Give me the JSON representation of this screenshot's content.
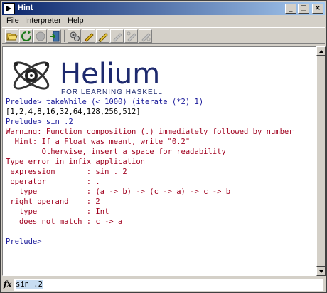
{
  "window": {
    "title": "Hint"
  },
  "title_buttons": {
    "minimize": "_",
    "maximize": "□",
    "close": "×"
  },
  "menu": {
    "file": {
      "first": "F",
      "rest": "ile"
    },
    "interpreter": {
      "first": "I",
      "rest": "nterpreter"
    },
    "help": {
      "first": "H",
      "rest": "elp"
    }
  },
  "toolbar": {
    "buttons": [
      "open-folder-icon",
      "reload-icon",
      "stop-icon",
      "exit-icon",
      "settings-icon",
      "edit-icon",
      "edit-file-icon",
      "edit-error-icon",
      "disabled-edit-icon",
      "disabled-edit-icon-2"
    ]
  },
  "logo": {
    "name": "Helium",
    "tagline": "FOR LEARNING HASKELL",
    "colors": {
      "name": "#1e2a6e",
      "tagline": "#1e2a6e",
      "atom": "#2a2a2a"
    }
  },
  "output": {
    "lines": [
      {
        "text": "Prelude> takeWhile (< 1000) (iterate (*2) 1)",
        "color": "blue"
      },
      {
        "text": "[1,2,4,8,16,32,64,128,256,512]",
        "color": "black"
      },
      {
        "text": "Prelude> sin .2",
        "color": "blue"
      },
      {
        "text": "Warning: Function composition (.) immediately followed by number",
        "color": "red"
      },
      {
        "text": "  Hint: If a Float was meant, write \"0.2\"",
        "color": "red"
      },
      {
        "text": "        Otherwise, insert a space for readability",
        "color": "red"
      },
      {
        "text": "Type error in infix application",
        "color": "red"
      },
      {
        "text": " expression       : sin . 2",
        "color": "red"
      },
      {
        "text": " operator         : .",
        "color": "red"
      },
      {
        "text": "   type           : (a -> b) -> (c -> a) -> c -> b",
        "color": "red"
      },
      {
        "text": " right operand    : 2",
        "color": "red"
      },
      {
        "text": "   type           : Int",
        "color": "red"
      },
      {
        "text": "   does not match : c -> a",
        "color": "red"
      },
      {
        "text": "",
        "color": "black"
      },
      {
        "text": "Prelude>",
        "color": "blue"
      }
    ]
  },
  "input": {
    "label": "fx",
    "value": "sin .2"
  },
  "colors": {
    "prompt": "#1a1a9a",
    "error": "#a0001e",
    "titlebar_start": "#0a246a",
    "titlebar_end": "#a6caf0"
  }
}
